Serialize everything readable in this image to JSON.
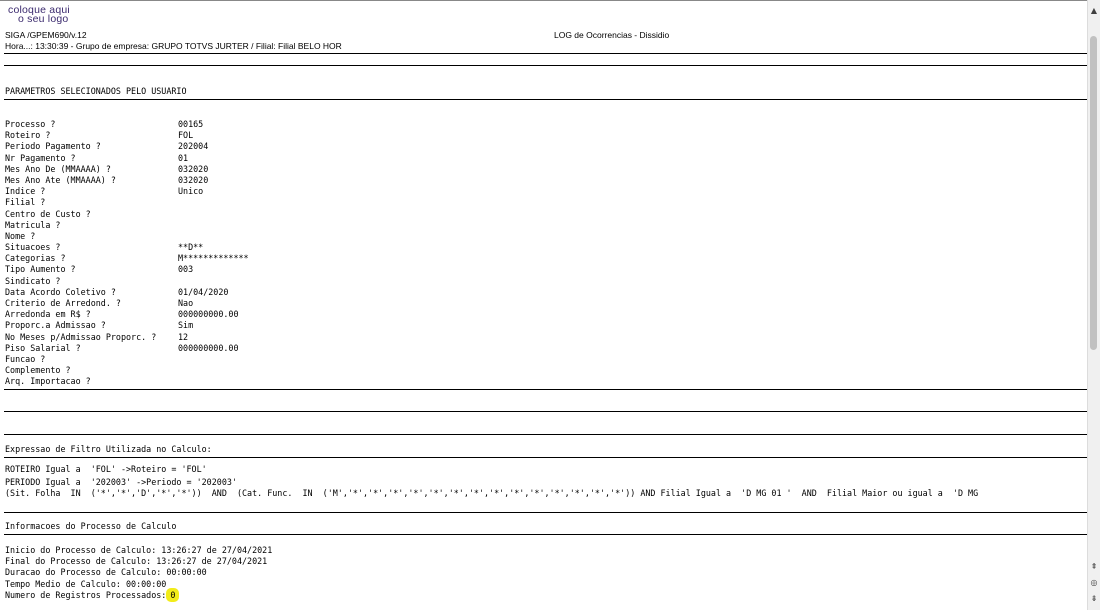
{
  "logo": {
    "line1": "coloque aqui",
    "line2": "o seu logo"
  },
  "header": {
    "program": "SIGA /GPEM690/v.12",
    "report_title": "LOG de Ocorrencias - Dissidio",
    "info": "Hora...: 13:30:39 - Grupo de empresa: GRUPO TOTVS JURTER / Filial: Filial BELO HOR"
  },
  "params_section_title": "PARAMETROS SELECIONADOS PELO USUARIO",
  "params": [
    {
      "label": "Processo ?",
      "value": "00165"
    },
    {
      "label": "Roteiro ?",
      "value": "FOL"
    },
    {
      "label": "Periodo Pagamento ?",
      "value": "202004"
    },
    {
      "label": "Nr Pagamento ?",
      "value": "01"
    },
    {
      "label": "Mes Ano De (MMAAAA) ?",
      "value": "032020"
    },
    {
      "label": "Mes Ano Ate (MMAAAA) ?",
      "value": "032020"
    },
    {
      "label": "Indice ?",
      "value": "Unico"
    },
    {
      "label": "Filial ?",
      "value": ""
    },
    {
      "label": "Centro de Custo ?",
      "value": ""
    },
    {
      "label": "Matricula ?",
      "value": ""
    },
    {
      "label": "Nome ?",
      "value": ""
    },
    {
      "label": "Situacoes ?",
      "value": "**D**"
    },
    {
      "label": "Categorias ?",
      "value": "M*************"
    },
    {
      "label": "Tipo Aumento ?",
      "value": "003"
    },
    {
      "label": "Sindicato ?",
      "value": ""
    },
    {
      "label": "Data Acordo Coletivo ?",
      "value": "01/04/2020"
    },
    {
      "label": "Criterio de Arredond. ?",
      "value": "Nao"
    },
    {
      "label": "Arredonda em R$ ?",
      "value": "000000000.00"
    },
    {
      "label": "Proporc.a Admissao ?",
      "value": "Sim"
    },
    {
      "label": "No Meses p/Admissao Proporc. ?",
      "value": "12"
    },
    {
      "label": "Piso Salarial ?",
      "value": "000000000.00"
    },
    {
      "label": "Funcao ?",
      "value": ""
    },
    {
      "label": "Complemento ?",
      "value": ""
    },
    {
      "label": "Arq. Importacao ?",
      "value": ""
    }
  ],
  "filter": {
    "title": "Expressao de Filtro Utilizada no Calculo:",
    "lines": [
      "ROTEIRO Igual a  'FOL' ->Roteiro = 'FOL'",
      "PERIODO Igual a  '202003' ->Periodo = '202003'",
      "(Sit. Folha  IN  ('*','*','D','*','*'))  AND  (Cat. Func.  IN  ('M','*','*','*','*','*','*','*','*','*','*','*','*','*','*')) AND Filial Igual a  'D MG 01 '  AND  Filial Maior ou igual a  'D MG"
    ]
  },
  "calc_info": {
    "title": "Informacoes do Processo de Calculo",
    "lines": [
      "Inicio do Processo de Calculo: 13:26:27 de 27/04/2021",
      "Final do Processo de Calculo: 13:26:27 de 27/04/2021",
      "Duracao do Processo de Calculo: 00:00:00",
      "Tempo Medio de Calculo: 00:00:00"
    ],
    "records_label": "Numero de Registros Processados:",
    "records_value": "0"
  },
  "colors": {
    "highlight": "#f2ec1a",
    "logo": "#3b2a6e"
  }
}
